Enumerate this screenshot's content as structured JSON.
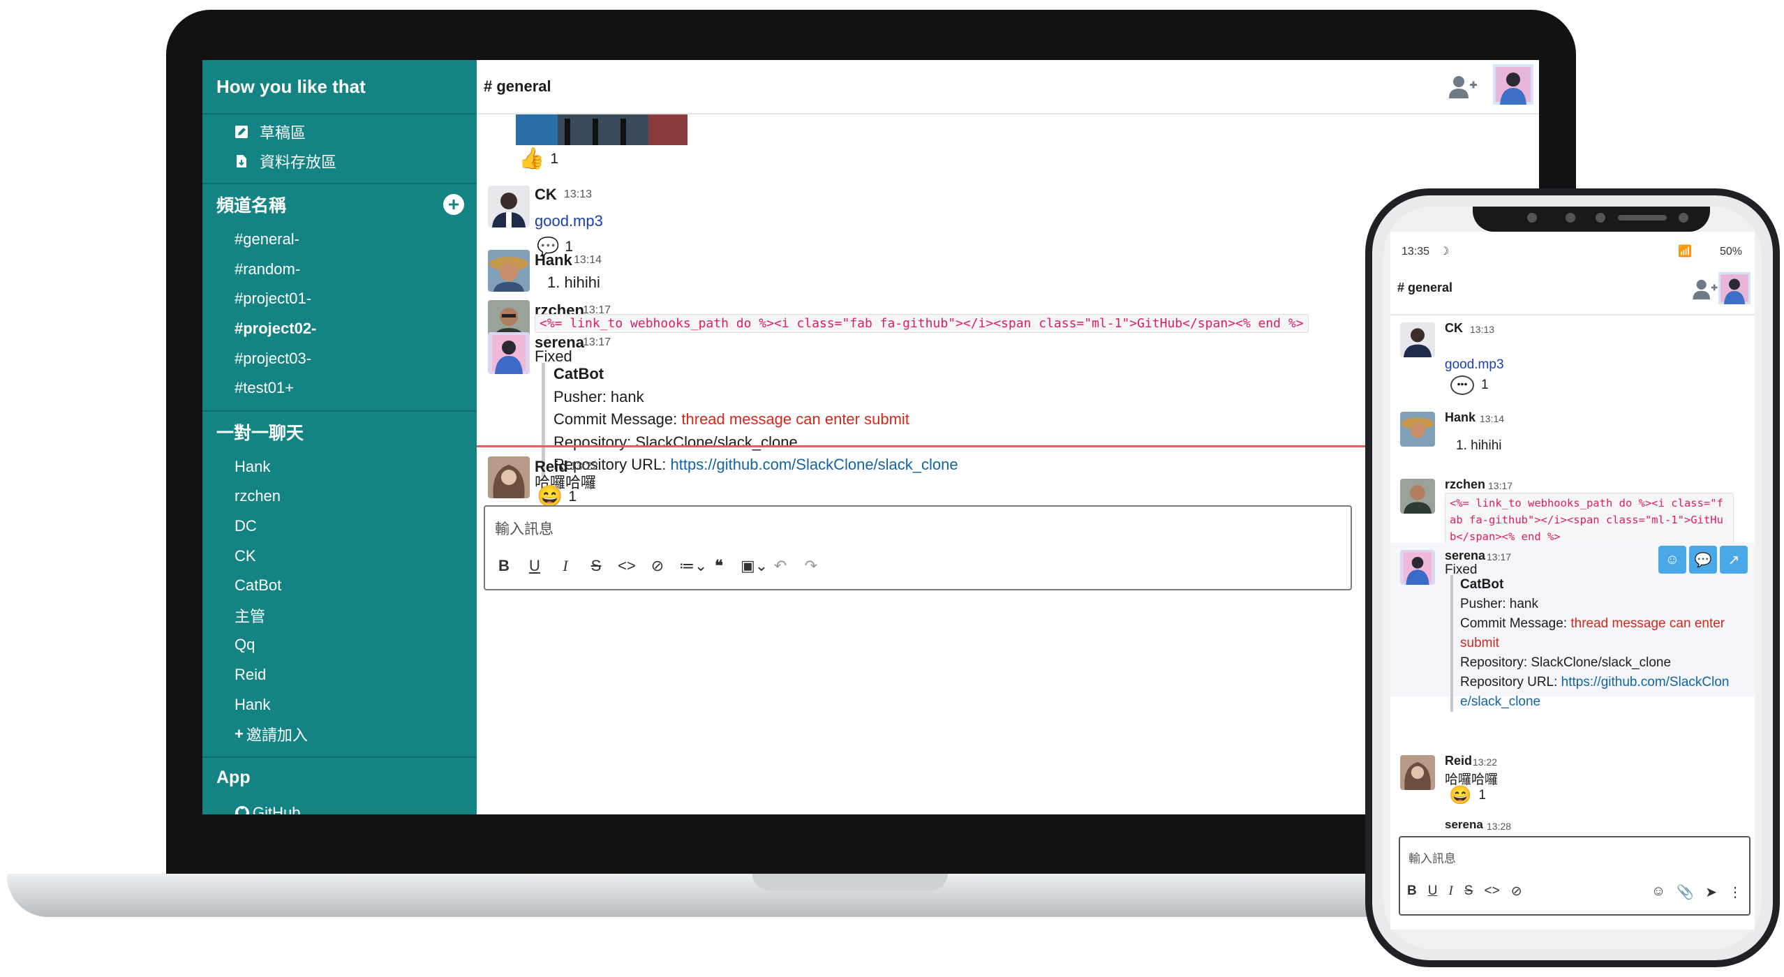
{
  "laptop": {
    "workspace": "How you like that",
    "nav": [
      "草稿區",
      "資料存放區"
    ],
    "channels_header": "頻道名稱",
    "channels": [
      "#general-",
      "#random-",
      "#project01-",
      "#project02-",
      "#project03-",
      "#test01+"
    ],
    "dm_header": "一對一聊天",
    "dms": [
      "Hank",
      "rzchen",
      "DC",
      "CK",
      "CatBot",
      "主管",
      "Qq",
      "Reid",
      "Hank"
    ],
    "invite": "邀請加入",
    "app_header": "App",
    "app_github": "GitHub",
    "channel_title": "# general",
    "messages": {
      "top_reaction": {
        "emoji": "👍",
        "count": "1"
      },
      "ck": {
        "name": "CK",
        "time": "13:13",
        "text": "good.mp3",
        "reaction": {
          "emoji": "💬",
          "count": "1"
        }
      },
      "hank": {
        "name": "Hank",
        "time": "13:14",
        "text": "1. hihihi"
      },
      "rzchen": {
        "name": "rzchen",
        "time": "13:17",
        "code": "<%= link_to webhooks_path do %><i class=\"fab fa-github\"></i><span class=\"ml-1\">GitHub</span><% end %>"
      },
      "serena": {
        "name": "serena",
        "time": "13:17",
        "text": "Fixed",
        "quote": {
          "title": "CatBot",
          "pusher": "Pusher: hank",
          "commit_label": "Commit Message: ",
          "commit": "thread message can enter submit",
          "repo": "Repository: SlackClone/slack_clone",
          "url_label": "Repository URL: ",
          "url": "https://github.com/SlackClone/slack_clone"
        }
      },
      "reid": {
        "name": "Reid",
        "time": "13:22",
        "text": "哈囉哈囉",
        "reaction": {
          "emoji": "😄",
          "count": "1"
        }
      }
    },
    "editor_placeholder": "輸入訊息"
  },
  "phone": {
    "status_time": "13:35",
    "status_battery": "50%",
    "channel_title": "# general",
    "ck": {
      "name": "CK",
      "time": "13:13",
      "text": "good.mp3",
      "count": "1"
    },
    "hank": {
      "name": "Hank",
      "time": "13:14",
      "text": "1. hihihi"
    },
    "rzchen": {
      "name": "rzchen",
      "time": "13:17",
      "code": "<%= link_to webhooks_path do %><i class=\"fab fa-github\"></i><span class=\"ml-1\">GitHub</span><% end %>"
    },
    "serena": {
      "name": "serena",
      "time": "13:17",
      "text": "Fixed",
      "quote": {
        "title": "CatBot",
        "pusher": "Pusher: hank",
        "commit_label": "Commit Message: ",
        "commit": "thread message can enter submit",
        "repo": "Repository: SlackClone/slack_clone",
        "url_label": "Repository URL: ",
        "url": "https://github.com/SlackClone/slack_clone"
      }
    },
    "reid": {
      "name": "Reid",
      "time": "13:22",
      "text": "哈囉哈囉",
      "count": "1"
    },
    "serena2": {
      "name": "serena",
      "time": "13:28"
    },
    "editor_placeholder": "輸入訊息"
  },
  "colors": {
    "sidebar": "#138483",
    "commit_red": "#d2281e",
    "link_blue": "#1264a3"
  }
}
